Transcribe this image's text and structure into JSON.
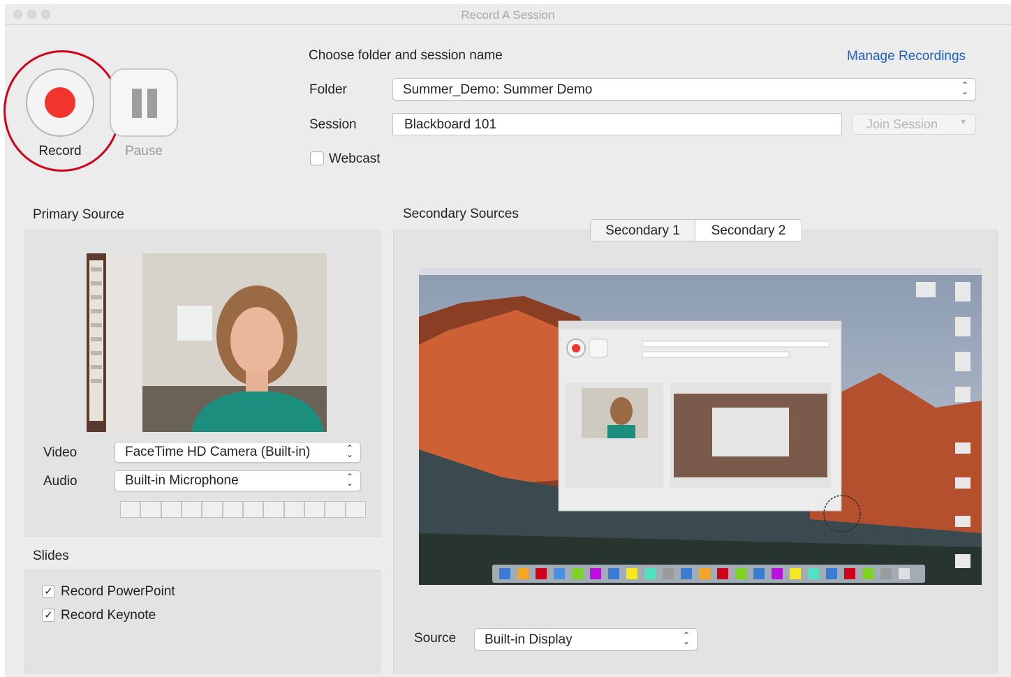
{
  "window": {
    "title": "Record A Session"
  },
  "controls": {
    "record_label": "Record",
    "pause_label": "Pause"
  },
  "session": {
    "heading": "Choose folder and session name",
    "manage_link": "Manage Recordings",
    "folder_label": "Folder",
    "folder_value": "Summer_Demo: Summer Demo",
    "session_label": "Session",
    "session_value": "Blackboard 101",
    "join_button": "Join Session",
    "webcast_label": "Webcast",
    "webcast_checked": false
  },
  "primary": {
    "heading": "Primary Source",
    "video_label": "Video",
    "video_value": "FaceTime HD Camera (Built-in)",
    "audio_label": "Audio",
    "audio_value": "Built-in Microphone",
    "meter_segments": 12
  },
  "slides": {
    "heading": "Slides",
    "items": [
      {
        "label": "Record PowerPoint",
        "checked": true
      },
      {
        "label": "Record Keynote",
        "checked": true
      }
    ]
  },
  "secondary": {
    "heading": "Secondary Sources",
    "tabs": [
      {
        "label": "Secondary 1",
        "selected": false
      },
      {
        "label": "Secondary 2",
        "selected": true
      }
    ],
    "source_label": "Source",
    "source_value": "Built-in Display"
  },
  "colors": {
    "record_red": "#f2342c",
    "highlight_ring": "#d0021b",
    "link_blue": "#1f5fbf"
  }
}
